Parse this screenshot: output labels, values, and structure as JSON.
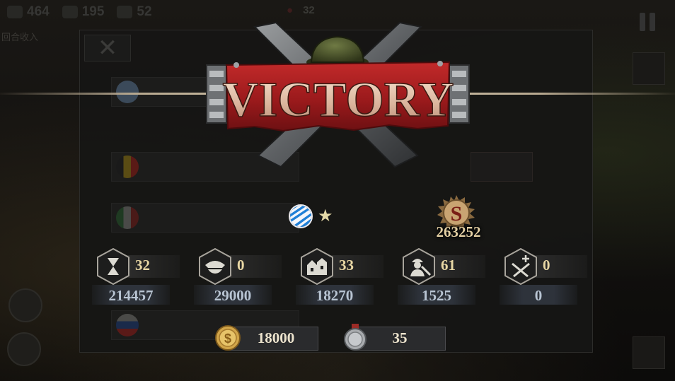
{
  "hud": {
    "stat1": "464",
    "stat2": "195",
    "stat3": "52",
    "center_count": "32",
    "sub_left": "回合收入"
  },
  "dialog": {
    "close_glyph": "✕"
  },
  "title": "VICTORY",
  "nation": {
    "flag": "bavaria-flag-icon",
    "stars": "★"
  },
  "score": {
    "icon": "score-medal-icon",
    "value": "263252"
  },
  "stats": [
    {
      "icon": "hourglass-icon",
      "count": "32",
      "total": "214457"
    },
    {
      "icon": "officer-cap-icon",
      "count": "0",
      "total": "29000"
    },
    {
      "icon": "city-icon",
      "count": "33",
      "total": "18270"
    },
    {
      "icon": "soldier-kill-icon",
      "count": "61",
      "total": "1525"
    },
    {
      "icon": "crossed-rifles-plus-icon",
      "count": "0",
      "total": "0"
    }
  ],
  "rewards": [
    {
      "icon": "gold-coin-icon",
      "value": "18000"
    },
    {
      "icon": "silver-medal-icon",
      "value": "35"
    }
  ],
  "colors": {
    "gold": "#e8d7a4",
    "silver": "#b8c4d2",
    "banner_red": "#a31c1e"
  }
}
